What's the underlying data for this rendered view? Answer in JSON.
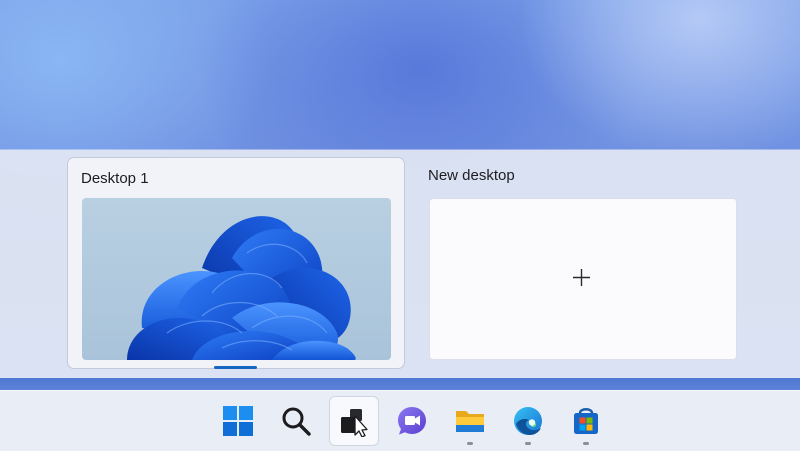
{
  "task_view": {
    "desktops": [
      {
        "name": "Desktop 1",
        "active": true
      }
    ],
    "new_desktop_label": "New desktop",
    "new_desktop_symbol": "+"
  },
  "taskbar": {
    "items": [
      {
        "icon": "windows-start-icon",
        "running": false
      },
      {
        "icon": "search-icon",
        "running": false
      },
      {
        "icon": "task-view-icon",
        "running": false,
        "active": true
      },
      {
        "icon": "teams-chat-icon",
        "running": false
      },
      {
        "icon": "file-explorer-icon",
        "running": true
      },
      {
        "icon": "edge-browser-icon",
        "running": true
      },
      {
        "icon": "microsoft-store-icon",
        "running": true
      }
    ]
  },
  "colors": {
    "accent": "#1566c0",
    "panel": "#e2e7f3",
    "taskbar": "#e9edf5"
  }
}
